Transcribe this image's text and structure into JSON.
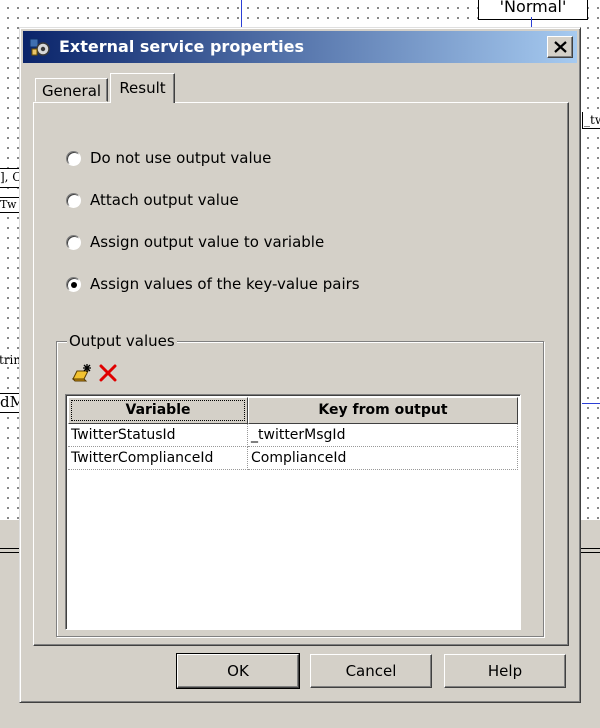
{
  "background": {
    "normal_label": "'Normal'",
    "fragment_left_1": "], C",
    "fragment_left_2": "Tw",
    "fragment_left_3": "trin",
    "fragment_left_4": "dM",
    "fragment_right": "_tw"
  },
  "dialog": {
    "title": "External service properties",
    "tabs": [
      {
        "label": "General",
        "active": false
      },
      {
        "label": "Result",
        "active": true
      }
    ],
    "options": [
      {
        "label": "Do not use output value",
        "checked": false
      },
      {
        "label": "Attach output value",
        "checked": false
      },
      {
        "label": "Assign output value to variable",
        "checked": false
      },
      {
        "label": "Assign values of the key-value pairs",
        "checked": true
      }
    ],
    "output_values": {
      "legend": "Output values",
      "columns": [
        "Variable",
        "Key from output"
      ],
      "rows": [
        {
          "variable": "TwitterStatusId",
          "key": "_twitterMsgId"
        },
        {
          "variable": "TwitterComplianceId",
          "key": "ComplianceId"
        }
      ]
    },
    "buttons": {
      "ok": "OK",
      "cancel": "Cancel",
      "help": "Help"
    }
  },
  "colors": {
    "title_bar_start": "#0a246a",
    "title_bar_end": "#a6caf0",
    "dialog_face": "#d4d0c8",
    "delete_icon": "#e00000",
    "canvas_line": "#2b3fd6"
  }
}
